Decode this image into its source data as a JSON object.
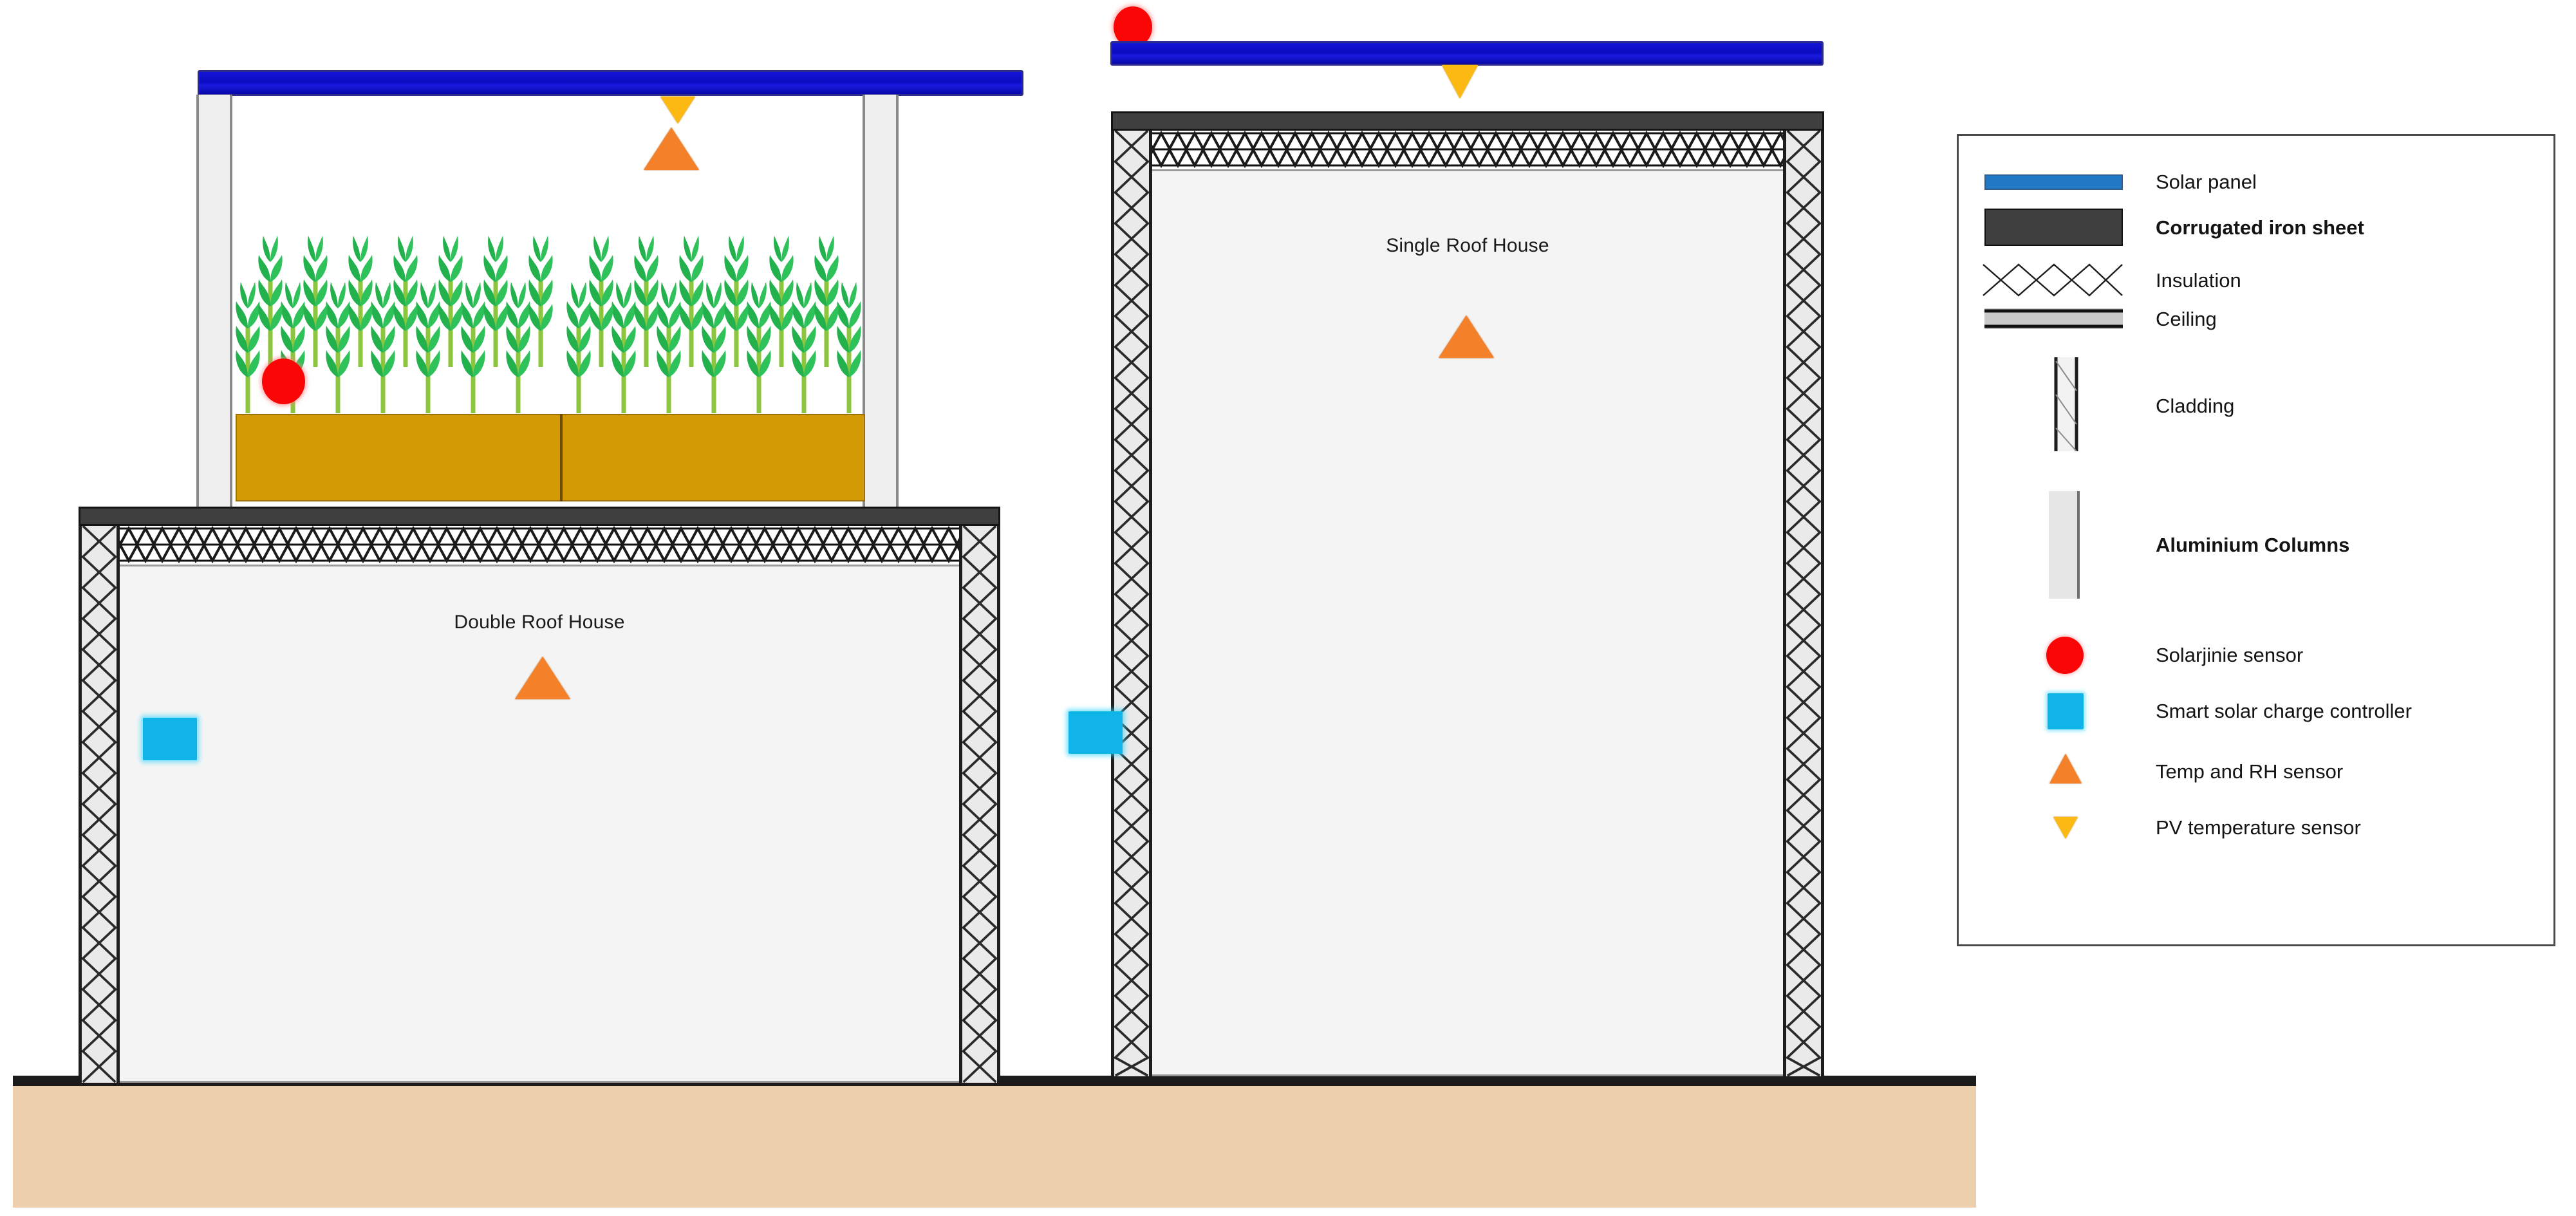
{
  "figure": {
    "type": "cross-section-diagram",
    "description": "Side-by-side cross sections of a Double Roof House and a Single Roof House with solar panels and sensor placement"
  },
  "houses": [
    {
      "id": "double-roof-house",
      "label": "Double Roof House",
      "upper_level": {
        "contents": "crop plants in soil beds",
        "plant_rows": 2,
        "plants_left_bed": 7,
        "plants_right_bed": 8
      },
      "sensors": [
        "pv-temperature-sensor",
        "temp-rh-sensor-upper",
        "solarjinie-sensor-crop",
        "temp-rh-sensor-lower",
        "smart-solar-charge-controller"
      ]
    },
    {
      "id": "single-roof-house",
      "label": "Single Roof House",
      "sensors": [
        "solarjinie-sensor-roof",
        "pv-temperature-sensor",
        "temp-rh-sensor",
        "smart-solar-charge-controller"
      ]
    }
  ],
  "legend": {
    "items": [
      {
        "label": "Solar panel",
        "icon": "solar-panel-swatch",
        "bold": false,
        "color": "#2178c4"
      },
      {
        "label": "Corrugated iron sheet",
        "icon": "corrugated-iron-swatch",
        "bold": true,
        "color": "#3f3f3f"
      },
      {
        "label": "Insulation",
        "icon": "insulation-swatch",
        "bold": false,
        "color": "#1d1d1d"
      },
      {
        "label": "Ceiling",
        "icon": "ceiling-swatch",
        "bold": false,
        "color": "#9a9a9a"
      },
      {
        "label": "Cladding",
        "icon": "cladding-swatch",
        "bold": false,
        "color": "#1d1d1d"
      },
      {
        "label": "Aluminium Columns",
        "icon": "aluminium-column-swatch",
        "bold": true,
        "color": "#e6e6e6"
      },
      {
        "label": "Solarjinie sensor",
        "icon": "solarjinie-sensor-icon",
        "bold": false,
        "color": "#fb0606"
      },
      {
        "label": "Smart solar charge controller",
        "icon": "charge-controller-icon",
        "bold": false,
        "color": "#11b4e8"
      },
      {
        "label": "Temp and RH sensor",
        "icon": "temp-rh-sensor-icon",
        "bold": false,
        "color": "#f5802a"
      },
      {
        "label": "PV temperature sensor",
        "icon": "pv-temp-sensor-icon",
        "bold": false,
        "color": "#fcb913"
      }
    ]
  },
  "colors": {
    "solar_panel_diagram": "#0b0bc0",
    "solar_panel_legend": "#2178c4",
    "corrugated_iron": "#3f3f3f",
    "soil_bed": "#d49a06",
    "ground": "#edcfae",
    "ground_line": "#1b1b1b",
    "room_interior": "#f4f4f4",
    "aluminium_column": "#efefef",
    "plant_leaf": "#22b14c",
    "plant_stem": "#8cc63f",
    "sensor_red": "#fb0606",
    "sensor_cyan": "#11b4e8",
    "sensor_orange": "#f5802a",
    "sensor_yellow": "#fcb913"
  }
}
